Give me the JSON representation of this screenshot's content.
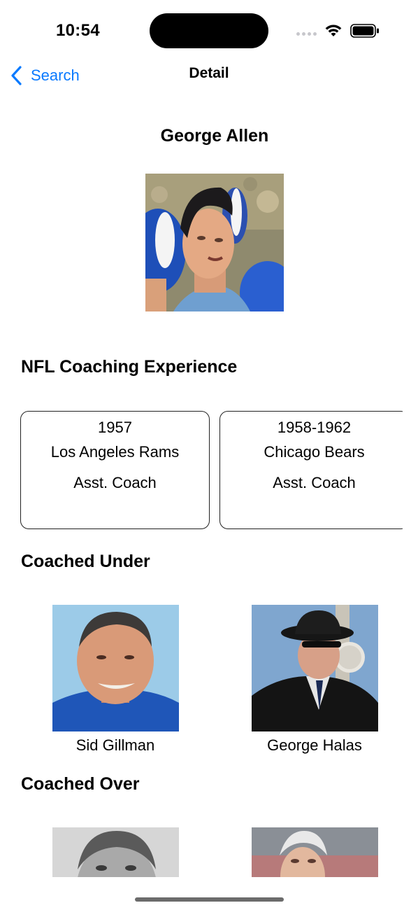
{
  "status_bar": {
    "time": "10:54"
  },
  "nav": {
    "back_label": "Search",
    "title": "Detail"
  },
  "person": {
    "name": "George Allen"
  },
  "sections": {
    "experience_title": "NFL Coaching Experience",
    "coached_under_title": "Coached Under",
    "coached_over_title": "Coached Over"
  },
  "experience": [
    {
      "years": "1957",
      "team": "Los Angeles Rams",
      "role": "Asst. Coach"
    },
    {
      "years": "1958-1962",
      "team": "Chicago Bears",
      "role": "Asst. Coach"
    }
  ],
  "coached_under": [
    {
      "name": "Sid Gillman"
    },
    {
      "name": "George Halas"
    }
  ],
  "colors": {
    "accent": "#0a7aff"
  }
}
